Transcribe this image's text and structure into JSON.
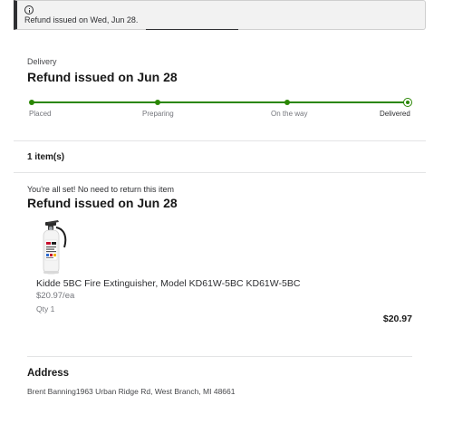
{
  "banner": {
    "icon": "info-icon",
    "message": "Refund issued on Wed, Jun 28."
  },
  "delivery": {
    "section_label": "Delivery",
    "title": "Refund issued on Jun 28",
    "progress_color": "#2a8703",
    "steps": [
      {
        "label": "Placed"
      },
      {
        "label": "Preparing"
      },
      {
        "label": "On the way"
      },
      {
        "label": "Delivered"
      }
    ]
  },
  "items": {
    "count_label": "1 item(s)",
    "note": "You're all set! No need to return this item",
    "title": "Refund issued on Jun 28",
    "products": [
      {
        "image_icon": "fire-extinguisher-image",
        "name": "Kidde 5BC Fire Extinguisher, Model KD61W-5BC KD61W-5BC",
        "unit_price": "$20.97/ea",
        "qty": "Qty 1",
        "total": "$20.97"
      }
    ]
  },
  "address": {
    "heading": "Address",
    "text": "Brent Banning1963 Urban Ridge Rd, West Branch, MI 48661"
  }
}
